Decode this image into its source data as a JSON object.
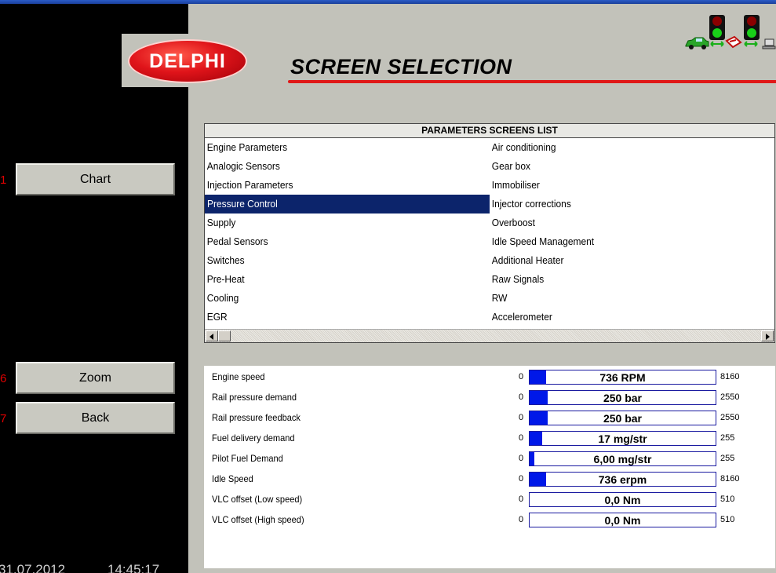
{
  "sidebar": {
    "buttons": [
      {
        "number": "1",
        "label": "Chart"
      },
      {
        "number": "6",
        "label": "Zoom"
      },
      {
        "number": "7",
        "label": "Back"
      }
    ],
    "date": "31.07.2012",
    "time": "14:45:17"
  },
  "header": {
    "logo_text": "DELPHI",
    "title": "SCREEN SELECTION"
  },
  "status_icons": [
    "car-icon",
    "traffic-light-icon",
    "link-arrow-icon",
    "ecu-icon",
    "traffic-light-icon",
    "link-arrow-icon",
    "computer-icon"
  ],
  "parameters_list": {
    "header": "PARAMETERS SCREENS LIST",
    "left_items": [
      "Engine Parameters",
      "Analogic Sensors",
      "Injection Parameters",
      "Pressure Control",
      "Supply",
      "Pedal Sensors",
      "Switches",
      "Pre-Heat",
      "Cooling",
      "EGR"
    ],
    "right_items": [
      "Air conditioning",
      "Gear box",
      "Immobiliser",
      "Injector corrections",
      "Overboost",
      "Idle Speed Management",
      "Additional Heater",
      "Raw Signals",
      "RW",
      "Accelerometer"
    ],
    "selected": "Pressure Control"
  },
  "live_params": [
    {
      "label": "Engine speed",
      "min": "0",
      "max": "8160",
      "value": "736 RPM",
      "fraction": 0.09
    },
    {
      "label": "Rail pressure demand",
      "min": "0",
      "max": "2550",
      "value": "250 bar",
      "fraction": 0.098
    },
    {
      "label": "Rail pressure feedback",
      "min": "0",
      "max": "2550",
      "value": "250 bar",
      "fraction": 0.098
    },
    {
      "label": "Fuel delivery demand",
      "min": "0",
      "max": "255",
      "value": "17 mg/str",
      "fraction": 0.067
    },
    {
      "label": "Pilot Fuel Demand",
      "min": "0",
      "max": "255",
      "value": "6,00 mg/str",
      "fraction": 0.024
    },
    {
      "label": "Idle Speed",
      "min": "0",
      "max": "8160",
      "value": "736 erpm",
      "fraction": 0.09
    },
    {
      "label": "VLC offset (Low speed)",
      "min": "0",
      "max": "510",
      "value": "0,0 Nm",
      "fraction": 0
    },
    {
      "label": "VLC offset (High speed)",
      "min": "0",
      "max": "510",
      "value": "0,0 Nm",
      "fraction": 0
    }
  ],
  "colors": {
    "selection": "#0c246b",
    "bar_fill": "#0018e8",
    "accent_red": "#e01818",
    "light_green": "#19d019",
    "light_red": "#8a0000"
  }
}
